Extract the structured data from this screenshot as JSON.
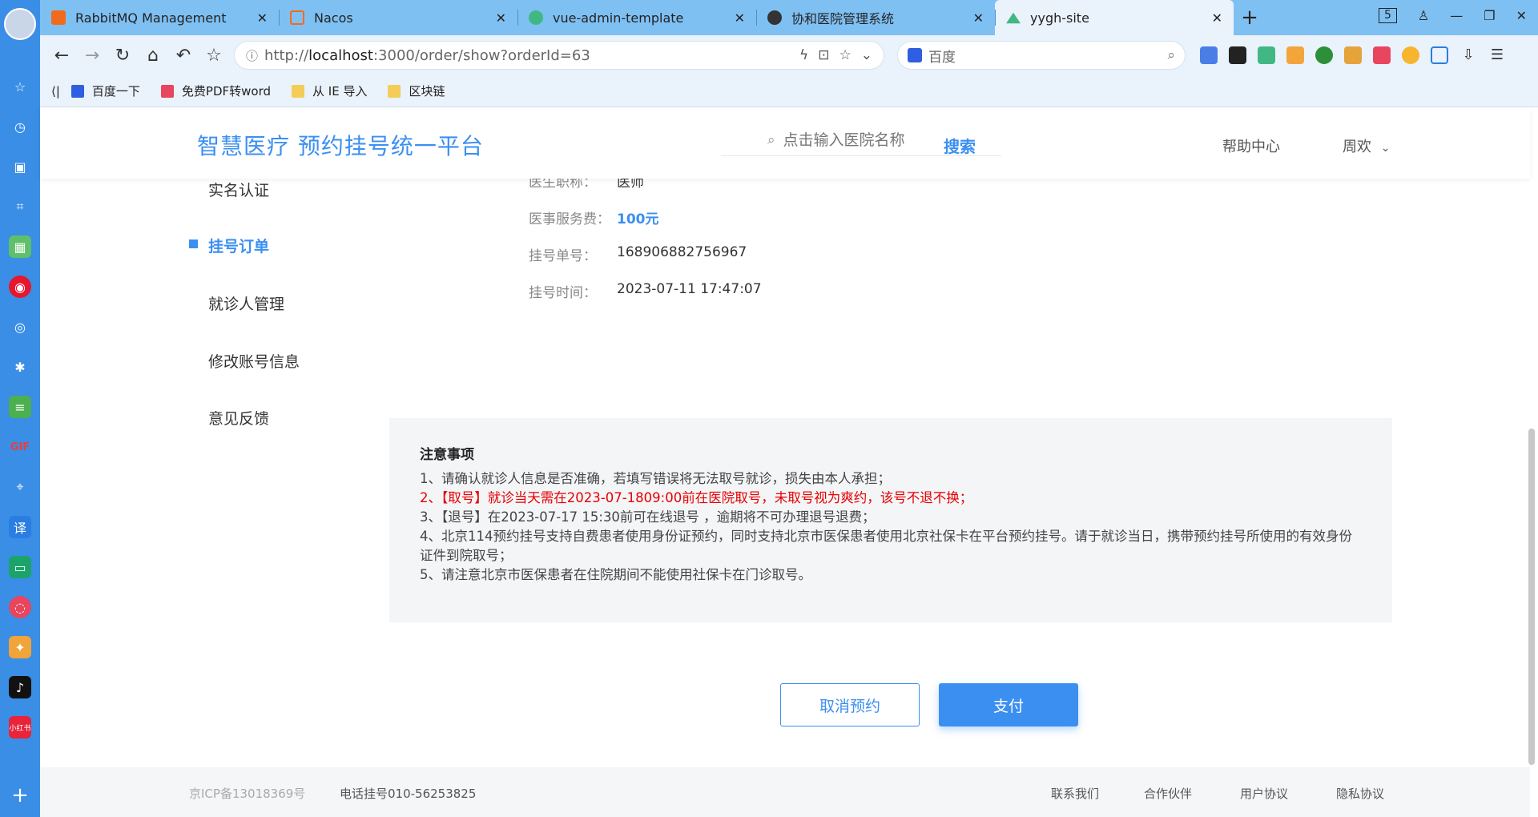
{
  "browser": {
    "tabs": [
      {
        "label": "RabbitMQ Management",
        "color": "#f26b1d"
      },
      {
        "label": "Nacos",
        "color": "#f26b1d"
      },
      {
        "label": "vue-admin-template",
        "color": "#41b883"
      },
      {
        "label": "协和医院管理系统",
        "color": "#333333"
      },
      {
        "label": "yygh-site",
        "color": "#41b883"
      }
    ],
    "tab_count": "5",
    "url_prefix": "http://",
    "url_host": "localhost",
    "url_rest": ":3000/order/show?orderId=63",
    "search_placeholder": "百度",
    "bookmarks": [
      "百度一下",
      "免费PDF转word",
      "从 IE 导入",
      "区块链"
    ]
  },
  "site": {
    "brand": "智慧医疗 预约挂号统一平台",
    "search_placeholder": "点击输入医院名称",
    "search_button": "搜索",
    "help": "帮助中心",
    "user": "周欢"
  },
  "menu": [
    "实名认证",
    "挂号订单",
    "就诊人管理",
    "修改账号信息",
    "意见反馈"
  ],
  "order": {
    "title_label": "医生职称：",
    "title_value": "医师",
    "fee_label": "医事服务费：",
    "fee_value": "100元",
    "no_label": "挂号单号：",
    "no_value": "168906882756967",
    "time_label": "挂号时间：",
    "time_value": "2023-07-11 17:47:07"
  },
  "notice": {
    "title": "注意事项",
    "lines": [
      "1、请确认就诊人信息是否准确，若填写错误将无法取号就诊，损失由本人承担；",
      "2、【取号】就诊当天需在2023-07-1809:00前在医院取号，未取号视为爽约，该号不退不换；",
      "3、【退号】在2023-07-17 15:30前可在线退号 ，逾期将不可办理退号退费；",
      "4、北京114预约挂号支持自费患者使用身份证预约，同时支持北京市医保患者使用北京社保卡在平台预约挂号。请于就诊当日，携带预约挂号所使用的有效身份证件到院取号；",
      "5、请注意北京市医保患者在住院期间不能使用社保卡在门诊取号。"
    ]
  },
  "buttons": {
    "cancel": "取消预约",
    "pay": "支付"
  },
  "footer": {
    "icp": "京ICP备13018369号",
    "phone": "电话挂号010-56253825",
    "links": [
      "联系我们",
      "合作伙伴",
      "用户协议",
      "隐私协议"
    ]
  }
}
